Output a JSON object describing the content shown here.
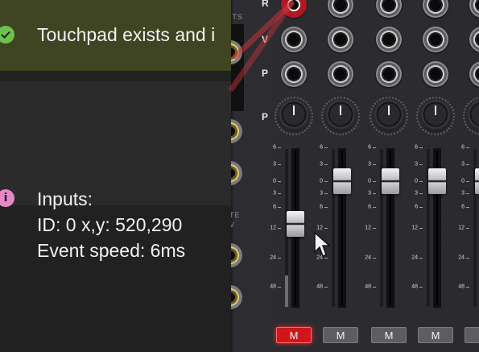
{
  "notifications": [
    {
      "icon": "check-circle-icon",
      "text": "Touchpad exists and i",
      "color": "#6cc24a"
    },
    {
      "icon": "info-icon",
      "lines": [
        "Inputs:",
        "ID: 0 x,y: 520,290",
        "Event speed: 6ms"
      ],
      "glyph": "i",
      "color": "#e58ac6"
    }
  ],
  "mixer": {
    "edge_labels": {
      "top": "RTS",
      "middle": "TE",
      "middle2": "V"
    },
    "row_labels": [
      "R",
      "V",
      "P",
      "P"
    ],
    "fader_scale": [
      "6",
      "3",
      "0",
      "3",
      "6",
      "12",
      "24",
      "48"
    ],
    "channels": [
      {
        "fader_db": "6",
        "meter_level": 0.2,
        "mute_label": "M",
        "mute_on": true
      },
      {
        "fader_db": "0",
        "meter_level": 0,
        "mute_label": "M",
        "mute_on": false
      },
      {
        "fader_db": "0",
        "meter_level": 0,
        "mute_label": "M",
        "mute_on": false
      },
      {
        "fader_db": "0",
        "meter_level": 0,
        "mute_label": "M",
        "mute_on": false
      }
    ]
  },
  "colors": {
    "toast_success_bg": "#3f4422",
    "accent_red": "#d0161d"
  }
}
